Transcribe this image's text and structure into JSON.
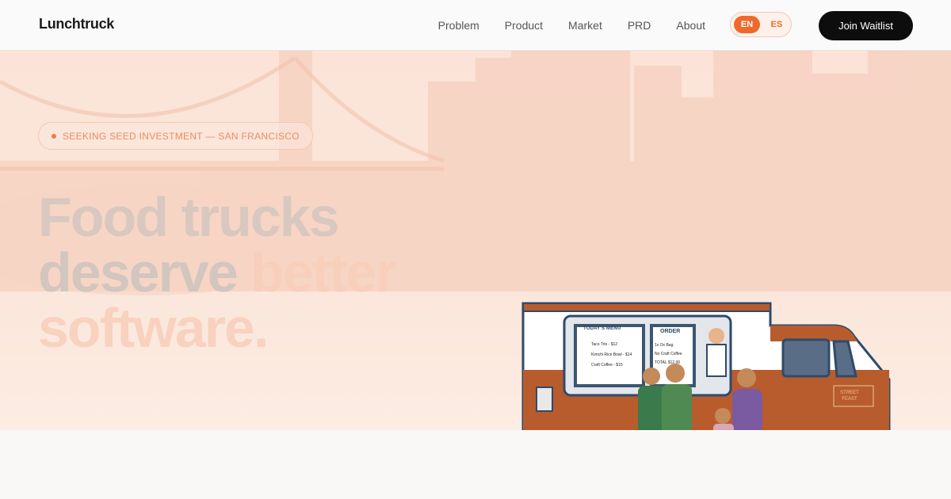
{
  "nav": {
    "logo": "Lunchtruck",
    "links": [
      "Problem",
      "Product",
      "Market",
      "PRD",
      "About"
    ],
    "lang_en": "EN",
    "lang_es": "ES",
    "cta": "Join Waitlist"
  },
  "hero": {
    "badge": "SEEKING SEED INVESTMENT — SAN FRANCISCO",
    "headline_line1": "Food trucks",
    "headline_line2_a": "deserve ",
    "headline_line2_b": "better",
    "headline_line3": "software."
  },
  "truck": {
    "menu_title": "TODAY'S MENU",
    "menu_items": [
      "Taco Trio - $12",
      "Kimchi Rice Bowl - $14",
      "Craft Coffee - $15"
    ],
    "order_title": "ORDER",
    "order_lines": [
      "1x Ox Bag",
      "No Craft Coffee",
      "TOTAL $12.00"
    ],
    "sign": "STREET FEAST"
  },
  "colors": {
    "accent": "#ee6a2c",
    "cta_bg": "#0d0d0d",
    "hero_bg": "#fbe3d7",
    "truck_body": "#b85c2e"
  }
}
